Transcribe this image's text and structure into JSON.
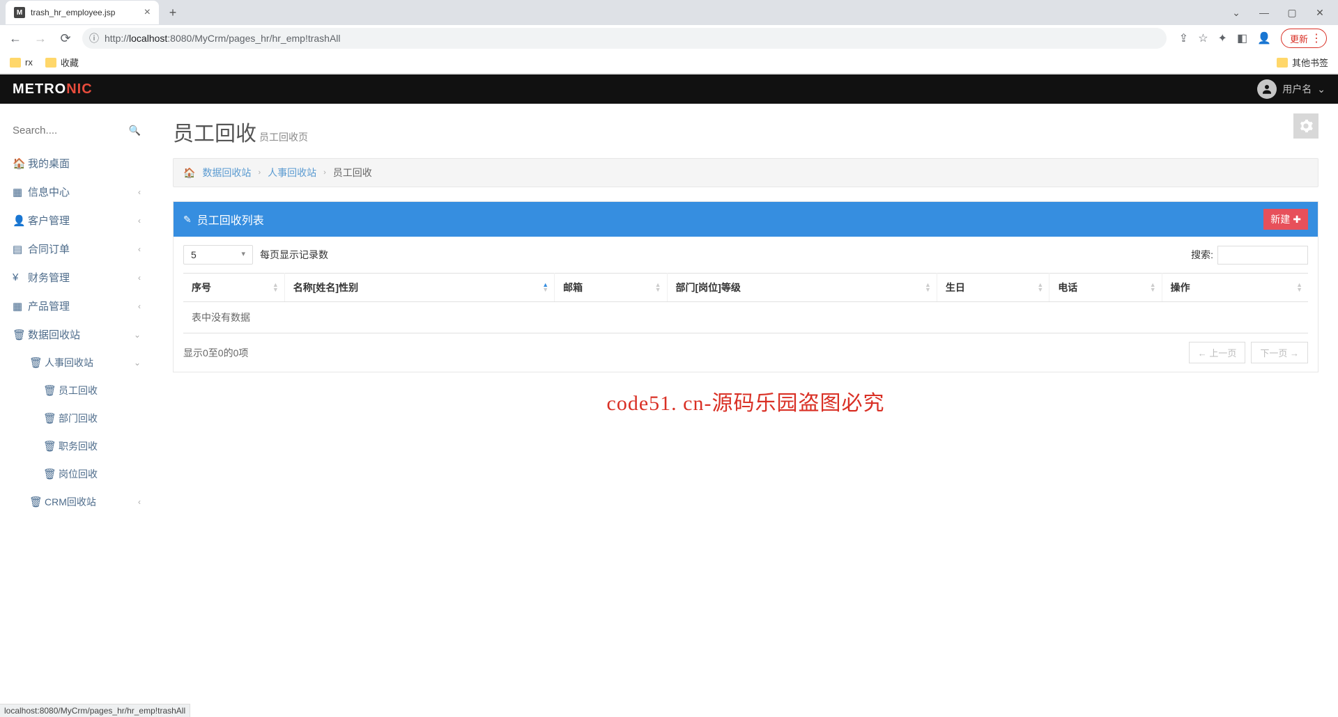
{
  "browser": {
    "tab_title": "trash_hr_employee.jsp",
    "url_prefix": "http://",
    "url_host": "localhost",
    "url_port": ":8080",
    "url_path": "/MyCrm/pages_hr/hr_emp!trashAll",
    "update_label": "更新",
    "bookmarks": {
      "b1": "rx",
      "b2": "收藏",
      "other": "其他书签"
    }
  },
  "logo": {
    "part1": "METRO",
    "part2": "NIC"
  },
  "user": {
    "name": "用户名"
  },
  "sidebar": {
    "search_placeholder": "Search....",
    "items": {
      "desktop": "我的桌面",
      "info": "信息中心",
      "customer": "客户管理",
      "contract": "合同订单",
      "finance": "财务管理",
      "product": "产品管理",
      "recycle": "数据回收站"
    },
    "sub_recycle": {
      "hr": "人事回收站",
      "crm": "CRM回收站"
    },
    "sub_hr": {
      "emp": "员工回收",
      "dept": "部门回收",
      "job": "职务回收",
      "pos": "岗位回收"
    }
  },
  "page": {
    "title": "员工回收",
    "subtitle": "员工回收页"
  },
  "breadcrumb": {
    "b1": "数据回收站",
    "b2": "人事回收站",
    "b3": "员工回收"
  },
  "panel": {
    "title": "员工回收列表",
    "new_btn": "新建"
  },
  "table": {
    "page_size": "5",
    "page_size_label": "每页显示记录数",
    "search_label": "搜索:",
    "headers": {
      "seq": "序号",
      "name": "名称[姓名]性别",
      "email": "邮箱",
      "dept": "部门[岗位]等级",
      "birthday": "生日",
      "phone": "电话",
      "ops": "操作"
    },
    "empty": "表中没有数据",
    "info": "显示0至0的0项",
    "prev": "← 上一页",
    "next": "下一页 →"
  },
  "watermark": "code51. cn-源码乐园盗图必究",
  "status_bar": "localhost:8080/MyCrm/pages_hr/hr_emp!trashAll"
}
